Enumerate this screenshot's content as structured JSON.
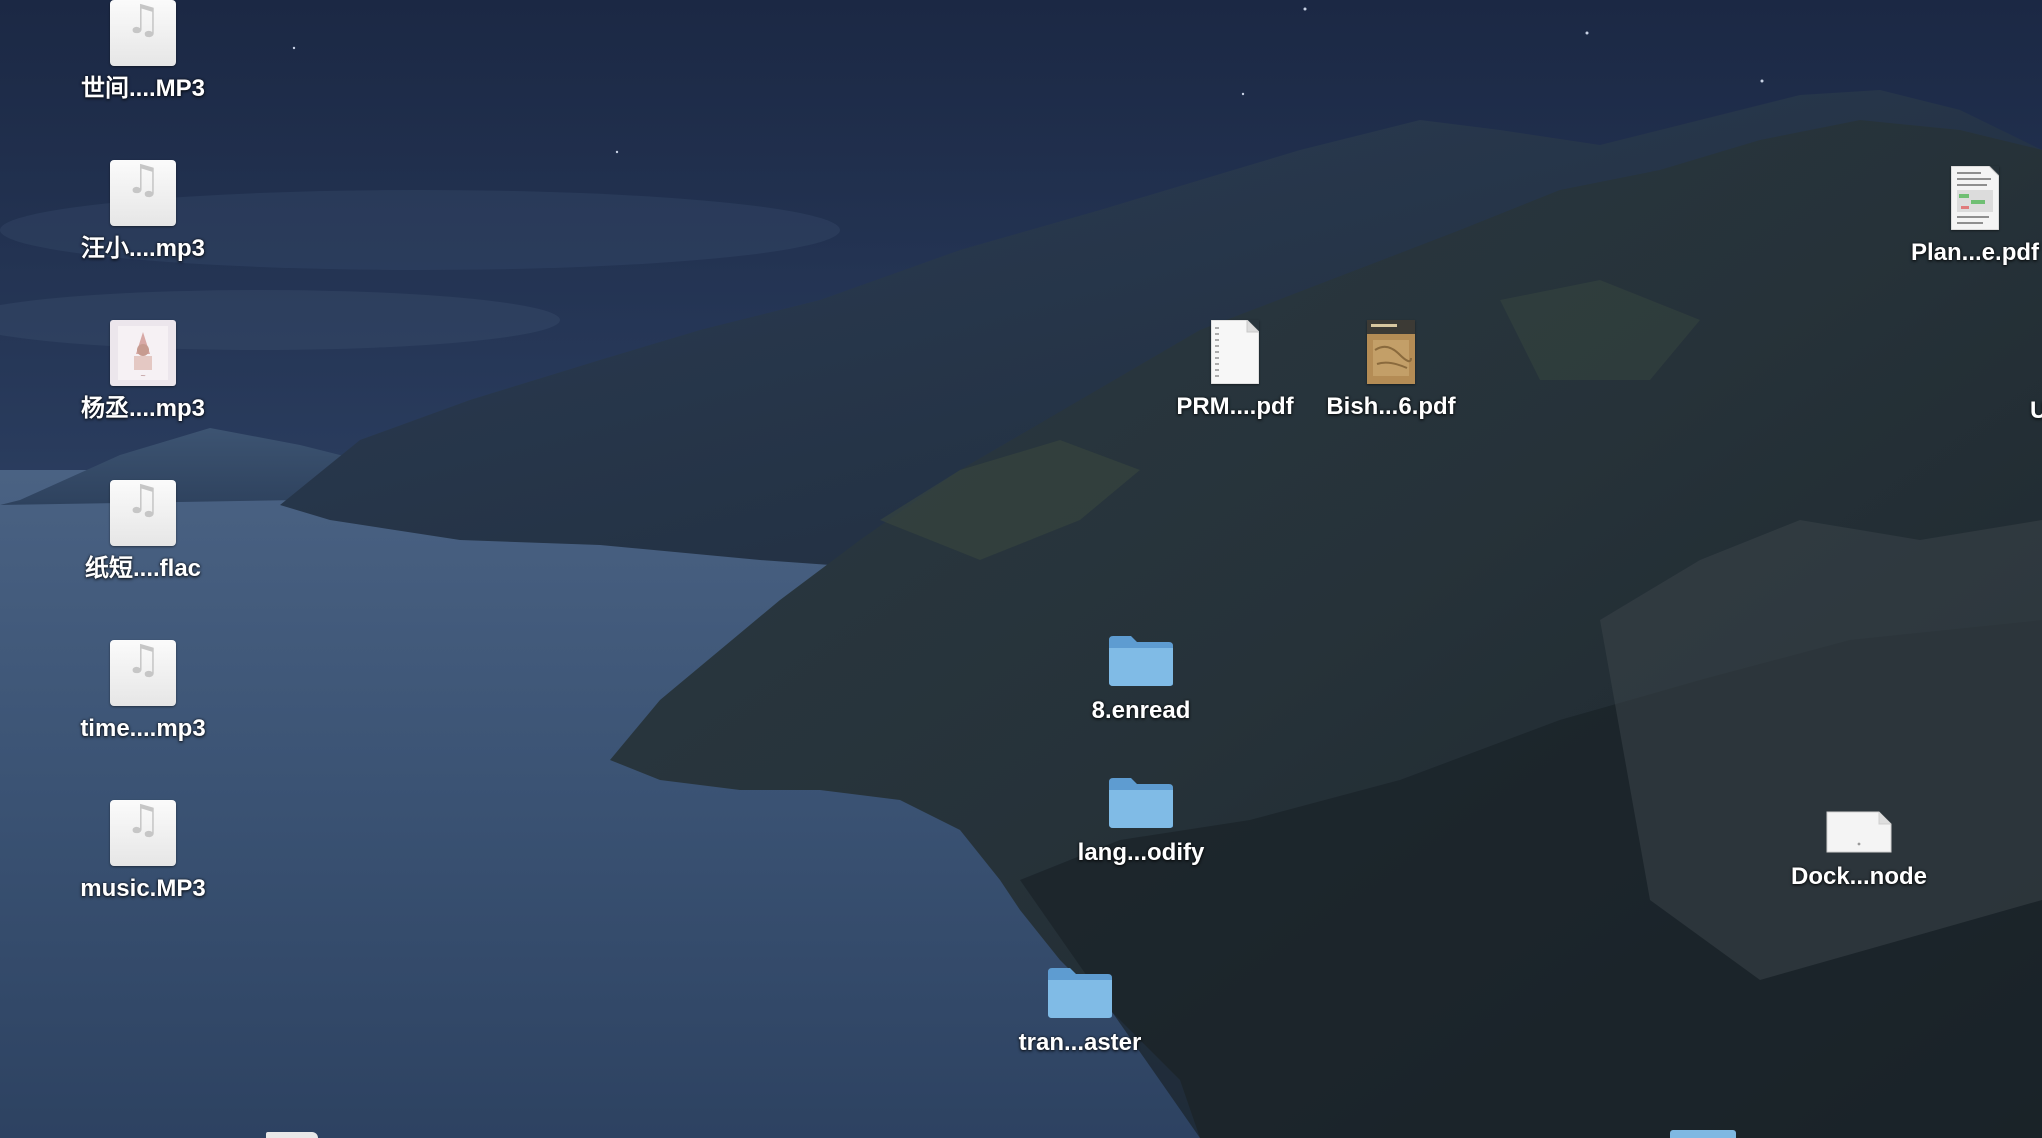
{
  "desktop": {
    "icons": [
      {
        "label": "世间....MP3",
        "icon": "music-file-icon",
        "kind": "music"
      },
      {
        "label": "汪小....mp3",
        "icon": "music-file-icon",
        "kind": "music"
      },
      {
        "label": "杨丞....mp3",
        "icon": "album-art-icon",
        "kind": "art"
      },
      {
        "label": "纸短....flac",
        "icon": "music-file-icon",
        "kind": "music"
      },
      {
        "label": "time....mp3",
        "icon": "music-file-icon",
        "kind": "music"
      },
      {
        "label": "music.MP3",
        "icon": "music-file-icon",
        "kind": "music"
      },
      {
        "label": "PRM....pdf",
        "icon": "pdf-document-icon",
        "kind": "pdf"
      },
      {
        "label": "Bish...6.pdf",
        "icon": "pdf-document-icon",
        "kind": "pdf-brown"
      },
      {
        "label": "Plan...e.pdf",
        "icon": "pdf-document-icon",
        "kind": "pdf-sheet"
      },
      {
        "label": "8.enread",
        "icon": "folder-icon",
        "kind": "folder"
      },
      {
        "label": "lang...odify",
        "icon": "folder-icon",
        "kind": "folder"
      },
      {
        "label": "tran...aster",
        "icon": "folder-icon",
        "kind": "folder"
      },
      {
        "label": "Dock...node",
        "icon": "blank-document-icon",
        "kind": "blank"
      },
      {
        "label": "U",
        "icon": "truncated-label",
        "kind": "label-only"
      }
    ]
  },
  "colors": {
    "sky": "#1f2d48",
    "sea": "#3a5170",
    "folder_blue": "#7bb3de",
    "label_text": "#ffffff"
  }
}
